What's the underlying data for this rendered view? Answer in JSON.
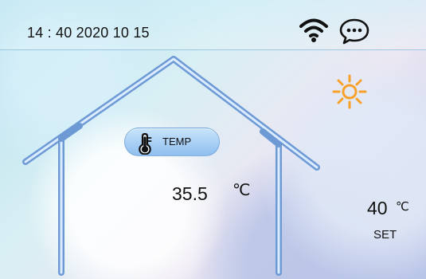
{
  "status_bar": {
    "time_date": "14 : 40 2020 10 15",
    "wifi_icon": "wifi-icon",
    "chat_icon": "chat-bubble-icon"
  },
  "weather": {
    "icon": "sun-icon",
    "accent_color": "#f7a12b"
  },
  "current": {
    "badge_label": "TEMP",
    "temperature": "35.5",
    "unit": "℃"
  },
  "setpoint": {
    "temperature": "40",
    "unit": "℃",
    "label": "SET"
  },
  "colors": {
    "house_outline": "#6d99d5",
    "pill_blue": "#9ec9f2",
    "sun_orange": "#f7a12b",
    "text": "#111111"
  }
}
